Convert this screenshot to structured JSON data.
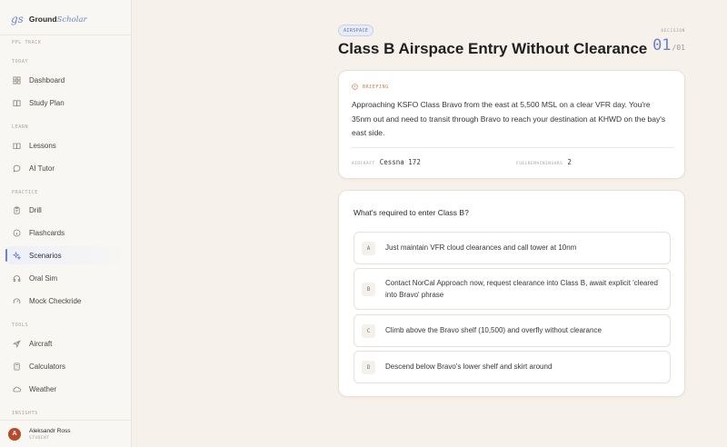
{
  "brand": {
    "mark": "gs",
    "name_bold": "Ground",
    "name_italic": "Scholar"
  },
  "sidebar": {
    "track_label": "PPL TRACK",
    "sections": {
      "today": "TODAY",
      "learn": "LEARN",
      "practice": "PRACTICE",
      "tools": "TOOLS",
      "insights": "INSIGHTS"
    },
    "items": {
      "dashboard": "Dashboard",
      "study_plan": "Study Plan",
      "lessons": "Lessons",
      "ai_tutor": "AI Tutor",
      "drill": "Drill",
      "flashcards": "Flashcards",
      "scenarios": "Scenarios",
      "oral_sim": "Oral Sim",
      "mock_checkride": "Mock Checkride",
      "aircraft": "Aircraft",
      "calculators": "Calculators",
      "weather": "Weather"
    },
    "active_item": "scenarios"
  },
  "user": {
    "initial": "A",
    "name": "Aleksandr Ross",
    "role": "STUDENT"
  },
  "scenario": {
    "tag": "AIRSPACE",
    "title": "Class B Airspace Entry Without Clearance",
    "decision_label": "DECISION",
    "decision_current": "01",
    "decision_total": "/01"
  },
  "briefing": {
    "label": "BRIEFING",
    "text": "Approaching KSFO Class Bravo from the east at 5,500 MSL on a clear VFR day. You're 35nm out and need to transit through Bravo to reach your destination at KHWD on the bay's east side.",
    "aircraft_label": "AIRCRAFT",
    "aircraft_value": "Cessna 172",
    "fuel_label": "FUELREMAININGHRS",
    "fuel_value": "2"
  },
  "question": {
    "prompt": "What's required to enter Class B?",
    "options": [
      {
        "letter": "A",
        "text": "Just maintain VFR cloud clearances and call tower at 10nm"
      },
      {
        "letter": "B",
        "text": "Contact NorCal Approach now, request clearance into Class B, await explicit 'cleared into Bravo' phrase"
      },
      {
        "letter": "C",
        "text": "Climb above the Bravo shelf (10,500) and overfly without clearance"
      },
      {
        "letter": "D",
        "text": "Descend below Bravo's lower shelf and skirt around"
      }
    ]
  },
  "colors": {
    "accent": "#6b84c8",
    "briefing_accent": "#d0774d",
    "avatar": "#b84a2c"
  }
}
